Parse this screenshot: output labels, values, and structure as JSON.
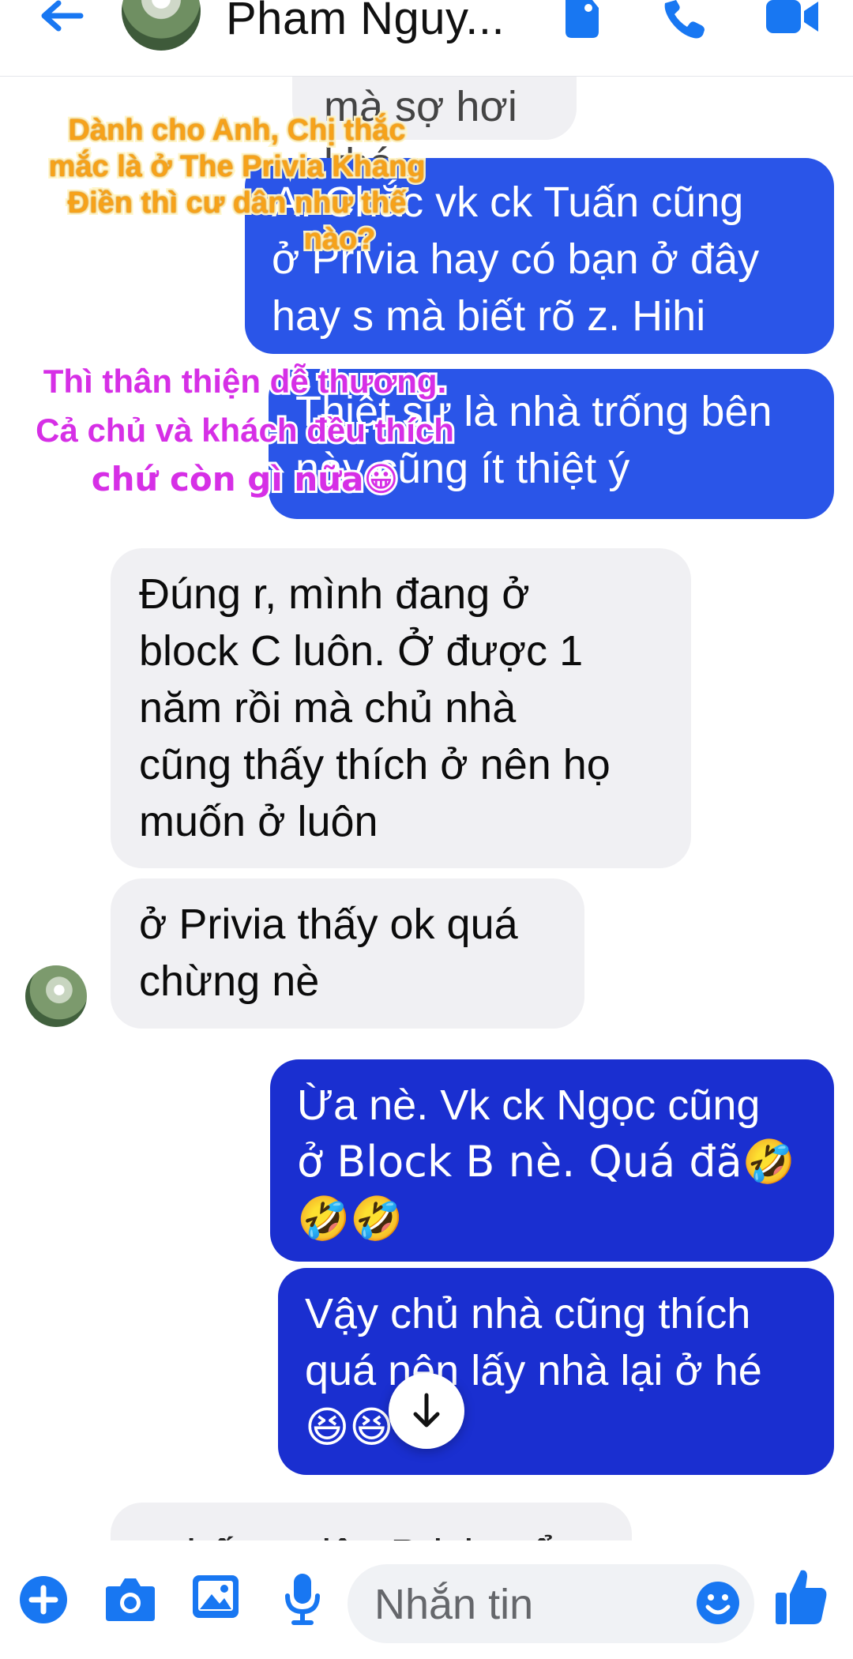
{
  "header": {
    "contact_name": "Pham Nguy...",
    "icons": [
      "back-arrow-icon",
      "tag-icon",
      "phone-icon",
      "video-camera-icon"
    ]
  },
  "messages": {
    "partial_top": "mà sợ hơi khó",
    "m1": [
      "A. Chắc vk  ck Tuấn cũng",
      "ở Privia hay có bạn ở đây",
      "hay s mà biết rõ z. Hihi"
    ],
    "m2": [
      "Thiệt sự là nhà trống bên",
      "này cũng ít thiệt ý"
    ],
    "m3": [
      "Đúng r, mình đang ở",
      "block C luôn. Ở được 1",
      "năm rồi mà chủ nhà",
      "cũng thấy thích ở nên họ",
      "muốn ở luôn"
    ],
    "m4": [
      "ở Privia thấy ok quá",
      "chừng nè"
    ],
    "m5": [
      "Ừa nè. Vk ck Ngọc cũng",
      "ở Block B nè. Quá đã🤣",
      "🤣🤣"
    ],
    "m6": [
      "Vậy chủ nhà cũng thích",
      "quá nên lấy nhà lại ở hé",
      "😆😆😆"
    ],
    "partial_bottom": "a thế cư dân Privia cổ"
  },
  "overlays": {
    "gold": [
      "Dành cho Anh, Chị thắc",
      "mắc là ở The Privia Khang",
      "Điền thì cư dân như thế",
      "nào?"
    ],
    "pink": [
      "Thì thân thiện dễ thương.",
      "Cả chủ và khách đều thích",
      "chứ còn gì nữa😀"
    ]
  },
  "composer": {
    "placeholder": "Nhắn tin",
    "icons": [
      "plus-icon",
      "camera-icon",
      "image-icon",
      "microphone-icon",
      "emoji-icon",
      "thumbs-up-icon"
    ]
  },
  "colors": {
    "accent": "#1877f2",
    "bubble_out": "#2a55e8",
    "bubble_out_dark": "#1a2fd0",
    "bubble_in": "#f0f0f3"
  }
}
